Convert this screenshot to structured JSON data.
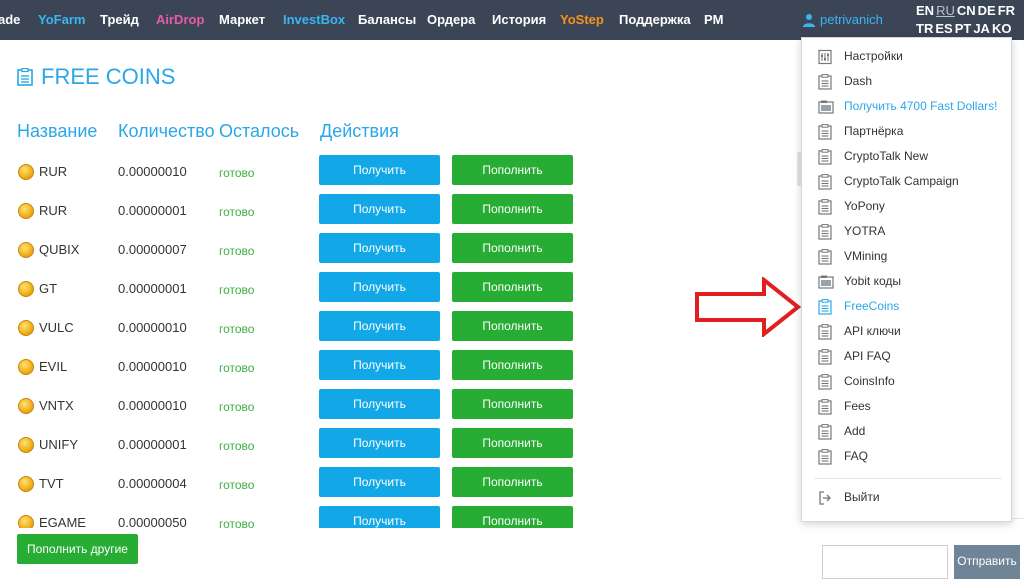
{
  "nav": {
    "items": [
      {
        "label": "ade",
        "color": "#ffffff"
      },
      {
        "label": "YoFarm",
        "color": "#39b6f2"
      },
      {
        "label": "Трейд",
        "color": "#ffffff"
      },
      {
        "label": "AirDrop",
        "color": "#e75aa8"
      },
      {
        "label": "Маркет",
        "color": "#ffffff"
      },
      {
        "label": "InvestBox",
        "color": "#39b6f2"
      },
      {
        "label": "Балансы",
        "color": "#ffffff"
      },
      {
        "label": "Ордера",
        "color": "#ffffff"
      },
      {
        "label": "История",
        "color": "#ffffff"
      },
      {
        "label": "YoStep",
        "color": "#f7941d"
      },
      {
        "label": "Поддержка",
        "color": "#ffffff"
      },
      {
        "label": "PM",
        "color": "#ffffff"
      }
    ],
    "username": "petrivanich",
    "languages": {
      "row1": [
        "EN",
        "RU",
        "CN",
        "DE",
        "FR"
      ],
      "row2": [
        "TR",
        "ES",
        "PT",
        "JA",
        "KO"
      ],
      "active": "RU"
    }
  },
  "page": {
    "title": "FREE COINS",
    "columns": [
      "Название",
      "Количество",
      "Осталось",
      "Действия"
    ]
  },
  "coins": [
    {
      "name": "RUR",
      "qty": "0.00000010",
      "left": "готово",
      "get": "Получить",
      "deposit": "Пополнить"
    },
    {
      "name": "RUR",
      "qty": "0.00000001",
      "left": "готово",
      "get": "Получить",
      "deposit": "Пополнить"
    },
    {
      "name": "QUBIX",
      "qty": "0.00000007",
      "left": "готово",
      "get": "Получить",
      "deposit": "Пополнить"
    },
    {
      "name": "GT",
      "qty": "0.00000001",
      "left": "готово",
      "get": "Получить",
      "deposit": "Пополнить"
    },
    {
      "name": "VULC",
      "qty": "0.00000010",
      "left": "готово",
      "get": "Получить",
      "deposit": "Пополнить"
    },
    {
      "name": "EVIL",
      "qty": "0.00000010",
      "left": "готово",
      "get": "Получить",
      "deposit": "Пополнить"
    },
    {
      "name": "VNTX",
      "qty": "0.00000010",
      "left": "готово",
      "get": "Получить",
      "deposit": "Пополнить"
    },
    {
      "name": "UNIFY",
      "qty": "0.00000001",
      "left": "готово",
      "get": "Получить",
      "deposit": "Пополнить"
    },
    {
      "name": "TVT",
      "qty": "0.00000004",
      "left": "готово",
      "get": "Получить",
      "deposit": "Пополнить"
    },
    {
      "name": "EGAME",
      "qty": "0.00000050",
      "left": "готово",
      "get": "Получить",
      "deposit": "Пополнить"
    }
  ],
  "footer": {
    "other_button": "Пополнить другие"
  },
  "chat": {
    "send": "Отправить"
  },
  "dropdown": {
    "items": [
      {
        "label": "Настройки",
        "icon": "settings-icon",
        "blue": false
      },
      {
        "label": "Dash",
        "icon": "page-icon",
        "blue": false
      },
      {
        "label": "Получить 4700 Fast Dollars!",
        "icon": "image-icon",
        "blue": true
      },
      {
        "label": "Партнёрка",
        "icon": "page-icon",
        "blue": false
      },
      {
        "label": "CryptoTalk New",
        "icon": "page-icon",
        "blue": false
      },
      {
        "label": "CryptoTalk Campaign",
        "icon": "page-icon",
        "blue": false
      },
      {
        "label": "YoPony",
        "icon": "page-icon",
        "blue": false
      },
      {
        "label": "YOTRA",
        "icon": "page-icon",
        "blue": false
      },
      {
        "label": "VMining",
        "icon": "page-icon",
        "blue": false
      },
      {
        "label": "Yobit коды",
        "icon": "image-icon",
        "blue": false
      },
      {
        "label": "FreeCoins",
        "icon": "page-icon",
        "blue": true
      },
      {
        "label": "API ключи",
        "icon": "page-icon",
        "blue": false
      },
      {
        "label": "API FAQ",
        "icon": "page-icon",
        "blue": false
      },
      {
        "label": "CoinsInfo",
        "icon": "page-icon",
        "blue": false
      },
      {
        "label": "Fees",
        "icon": "page-icon",
        "blue": false
      },
      {
        "label": "Add",
        "icon": "page-icon",
        "blue": false
      },
      {
        "label": "FAQ",
        "icon": "page-icon",
        "blue": false
      }
    ],
    "logout": "Выйти"
  },
  "colors": {
    "accent": "#2aa7e8",
    "get_button": "#12a8e8",
    "deposit_button": "#28ad34",
    "arrow": "#e02020",
    "nav_bg": "#3b4556"
  }
}
